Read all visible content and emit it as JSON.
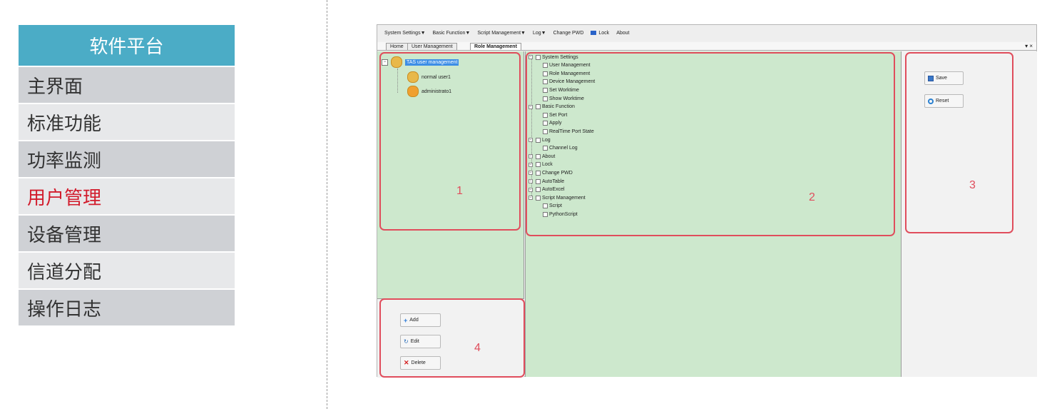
{
  "nav": {
    "title": "软件平台",
    "items": [
      {
        "label": "主界面"
      },
      {
        "label": "标准功能"
      },
      {
        "label": "功率监测"
      },
      {
        "label": "用户管理"
      },
      {
        "label": "设备管理"
      },
      {
        "label": "信道分配"
      },
      {
        "label": "操作日志"
      }
    ],
    "active_index": 3
  },
  "app": {
    "menu": [
      "System Settings▼",
      "Basic Function▼",
      "Script Management▼",
      "Log▼",
      "Change PWD",
      "Lock",
      "About"
    ],
    "tabs": [
      "Home",
      "User Management",
      "Role Management"
    ],
    "active_tab": "Role Management",
    "tab_controls": "▾ ×",
    "user_tree": {
      "root": "TAS user management",
      "children": [
        "normal user1",
        "administrato1"
      ]
    },
    "role_tree": [
      {
        "label": "System Settings",
        "level": 0
      },
      {
        "label": "User Management",
        "level": 1
      },
      {
        "label": "Role Management",
        "level": 1
      },
      {
        "label": "Device Management",
        "level": 1
      },
      {
        "label": "Set Worktime",
        "level": 1
      },
      {
        "label": "Show Worktime",
        "level": 1
      },
      {
        "label": "Basic Function",
        "level": 0
      },
      {
        "label": "Set Port",
        "level": 1
      },
      {
        "label": "Apply",
        "level": 1
      },
      {
        "label": "RealTime Port State",
        "level": 1
      },
      {
        "label": "Log",
        "level": 0
      },
      {
        "label": "Channel Log",
        "level": 1
      },
      {
        "label": "About",
        "level": 0
      },
      {
        "label": "Lock",
        "level": 0
      },
      {
        "label": "Change PWD",
        "level": 0
      },
      {
        "label": "AutoTable",
        "level": 0
      },
      {
        "label": "AutoExcel",
        "level": 0
      },
      {
        "label": "Script Management",
        "level": 0
      },
      {
        "label": "Script",
        "level": 1
      },
      {
        "label": "PythonScript",
        "level": 1
      }
    ],
    "buttons": {
      "add": "Add",
      "edit": "Edit",
      "delete": "Delete",
      "save": "Save",
      "reset": "Reset"
    }
  },
  "annotations": [
    "1",
    "2",
    "3",
    "4"
  ],
  "colors": {
    "nav_title_bg": "#4bacc6",
    "active_nav_text": "#d21c2c",
    "panel_green": "#cde8cd",
    "annotation_red": "#e04d5c"
  }
}
